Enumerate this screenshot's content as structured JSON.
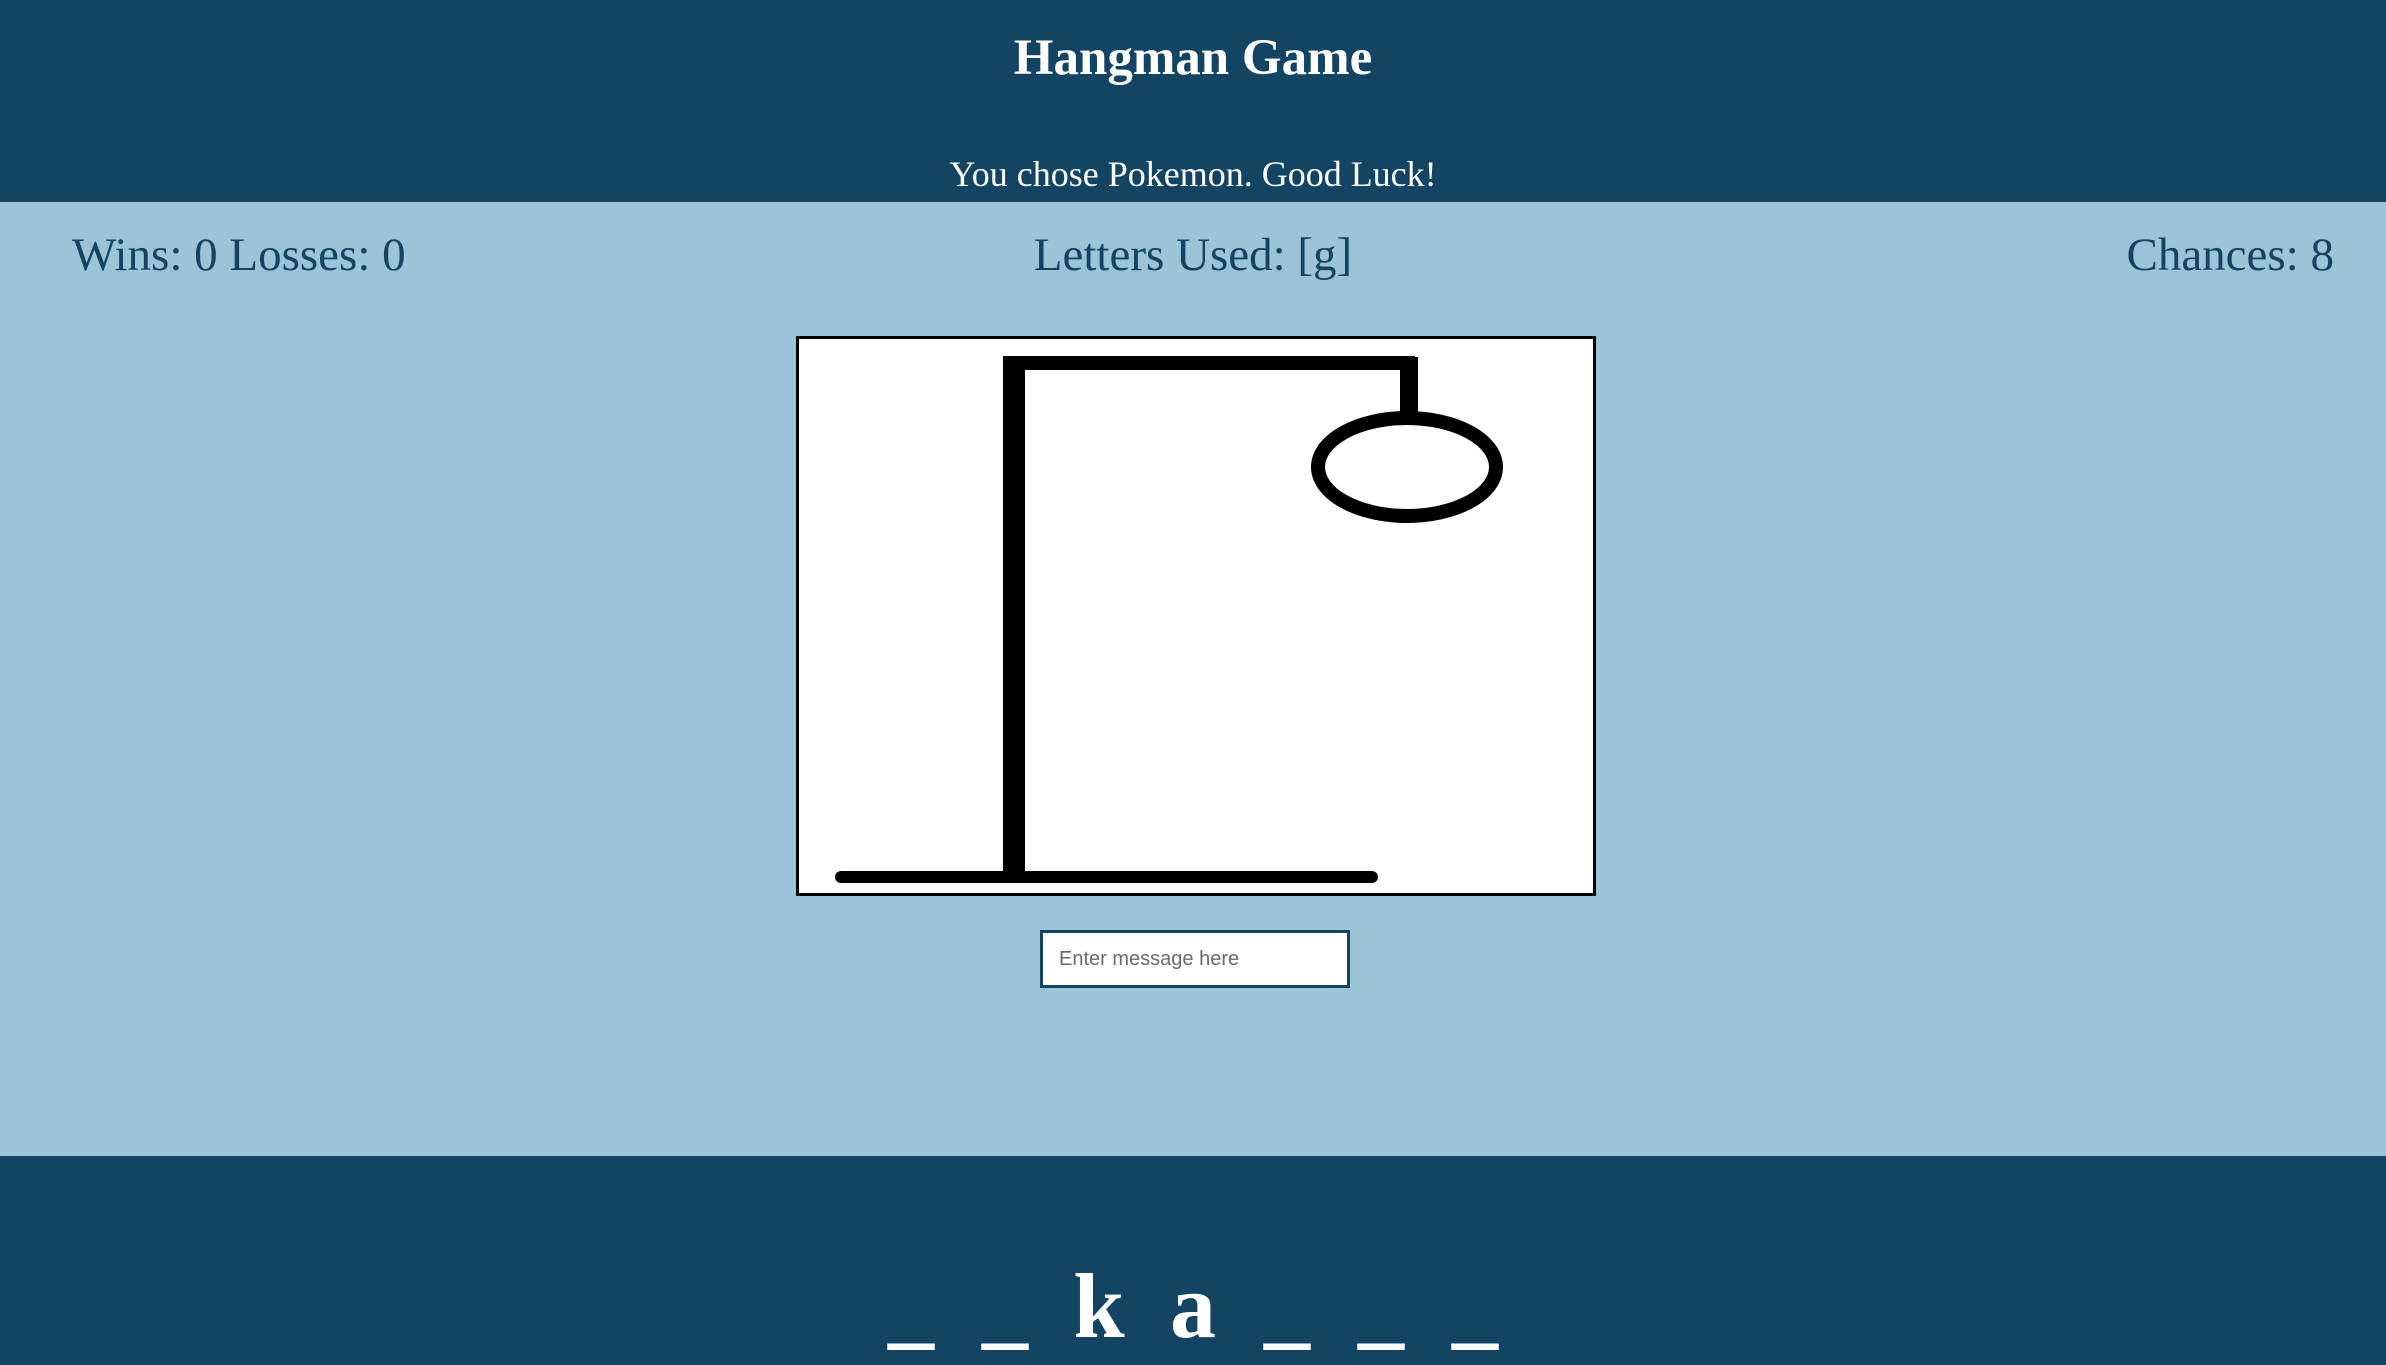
{
  "header": {
    "title": "Hangman Game",
    "subtitle": "You chose Pokemon. Good Luck!"
  },
  "stats": {
    "wins_losses": "Wins: 0 Losses: 0",
    "letters_used": "Letters Used: [g]",
    "chances": "Chances: 8"
  },
  "input": {
    "placeholder": "Enter message here",
    "value": ""
  },
  "word": {
    "slots": [
      "_",
      "_",
      "k",
      "a",
      "_",
      "_",
      "_"
    ]
  },
  "colors": {
    "header_bg": "#134464",
    "main_bg": "#9bc4d7",
    "text_dark": "#134464",
    "text_light": "#ffffff"
  }
}
